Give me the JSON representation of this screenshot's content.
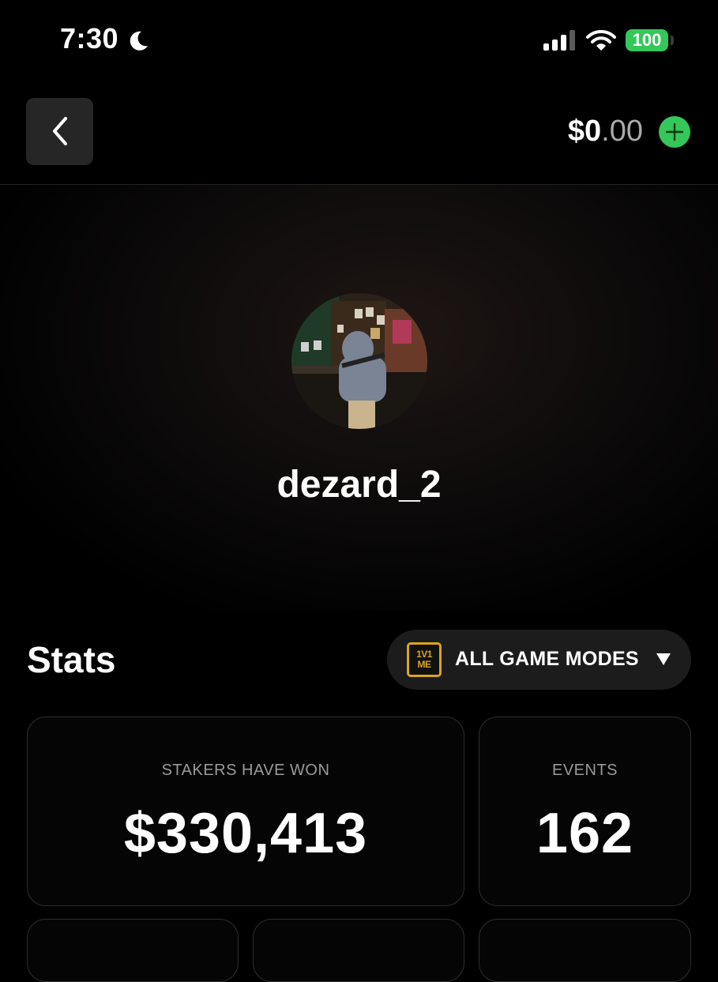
{
  "status_bar": {
    "time": "7:30",
    "battery": "100",
    "icons": [
      "moon-icon",
      "cellular-signal-icon",
      "wifi-icon",
      "battery-icon"
    ]
  },
  "header": {
    "back_icon": "chevron-left-icon",
    "balance_whole": "$0",
    "balance_cents": ".00",
    "add_icon": "plus-icon"
  },
  "profile": {
    "username": "dezard_2"
  },
  "stats": {
    "title": "Stats",
    "game_mode": {
      "logo_line1": "1V1",
      "logo_line2": "ME",
      "label": "ALL GAME MODES",
      "icon": "caret-down-icon"
    },
    "cards": [
      {
        "label": "STAKERS HAVE WON",
        "value": "$330,413"
      },
      {
        "label": "EVENTS",
        "value": "162"
      }
    ]
  },
  "colors": {
    "background": "#000000",
    "accent_green": "#34c759",
    "logo_gold": "#d9a520",
    "card_border": "#2e2e2e",
    "muted_text": "#9a9a9a"
  }
}
